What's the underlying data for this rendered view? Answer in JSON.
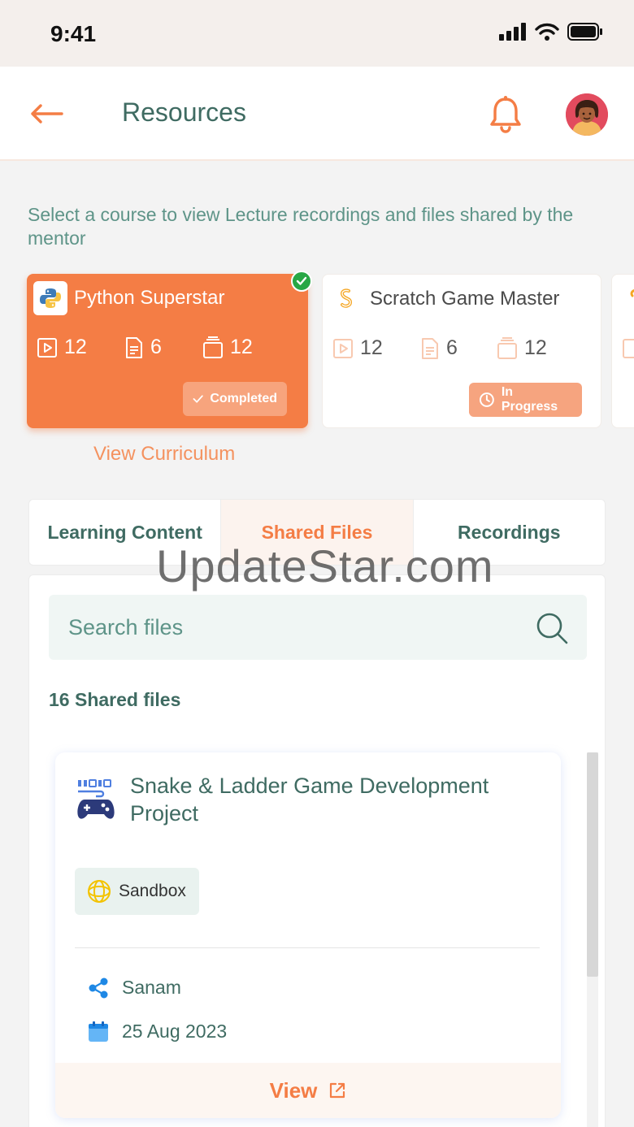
{
  "status_bar": {
    "time": "9:41"
  },
  "header": {
    "title": "Resources"
  },
  "intro": "Select a course to view Lecture recordings and files shared by the mentor",
  "courses": [
    {
      "name": "Python Superstar",
      "videos": "12",
      "docs": "6",
      "files": "12",
      "status": "Completed"
    },
    {
      "name": "Scratch Game Master",
      "videos": "12",
      "docs": "6",
      "files": "12",
      "status": "In Progress"
    }
  ],
  "view_curriculum": "View Curriculum",
  "tabs": [
    {
      "label": "Learning Content"
    },
    {
      "label": "Shared Files"
    },
    {
      "label": "Recordings"
    }
  ],
  "search": {
    "placeholder": "Search files"
  },
  "files_count": "16 Shared files",
  "file": {
    "title": "Snake & Ladder Game Development Project",
    "tag": "Sandbox",
    "shared_by": "Sanam",
    "date": "25 Aug 2023",
    "action": "View"
  },
  "watermark": "UpdateStar.com",
  "colors": {
    "accent": "#f47d45",
    "text": "#3f6b62",
    "success": "#28a745"
  }
}
